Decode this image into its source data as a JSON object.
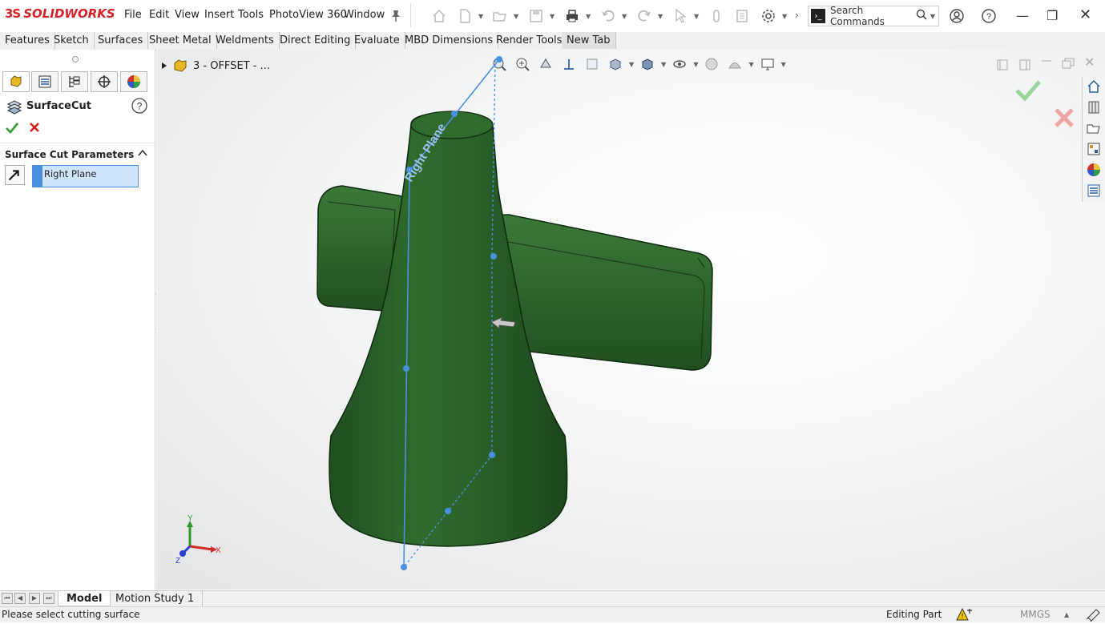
{
  "app": {
    "brand_ds": "3S",
    "brand_name": "SOLIDWORKS"
  },
  "menu": [
    "File",
    "Edit",
    "View",
    "Insert",
    "Tools",
    "PhotoView 360",
    "Window"
  ],
  "search": {
    "placeholder": "Search Commands"
  },
  "command_tabs": [
    "Features",
    "Sketch",
    "Surfaces",
    "Sheet Metal",
    "Weldments",
    "Direct Editing",
    "Evaluate",
    "MBD Dimensions",
    "Render Tools",
    "New Tab"
  ],
  "property_manager": {
    "title": "SurfaceCut",
    "section_title": "Surface Cut Parameters",
    "selection": "Right Plane"
  },
  "feature_tree": {
    "item": "3 - OFFSET - ..."
  },
  "viewport": {
    "plane_label": "Right Plane",
    "triad": {
      "x": "X",
      "y": "Y",
      "z": "Z"
    },
    "model_color": "#2e6b2c",
    "plane_color": "#4a90e2"
  },
  "bottom_tabs": [
    "Model",
    "Motion Study 1"
  ],
  "status": {
    "message": "Please select cutting surface",
    "mode": "Editing Part",
    "units": "MMGS"
  },
  "colors": {
    "brand": "#d62128",
    "accent": "#4a90e2",
    "confirm": "#2d9c2d",
    "cancel": "#d62020"
  }
}
